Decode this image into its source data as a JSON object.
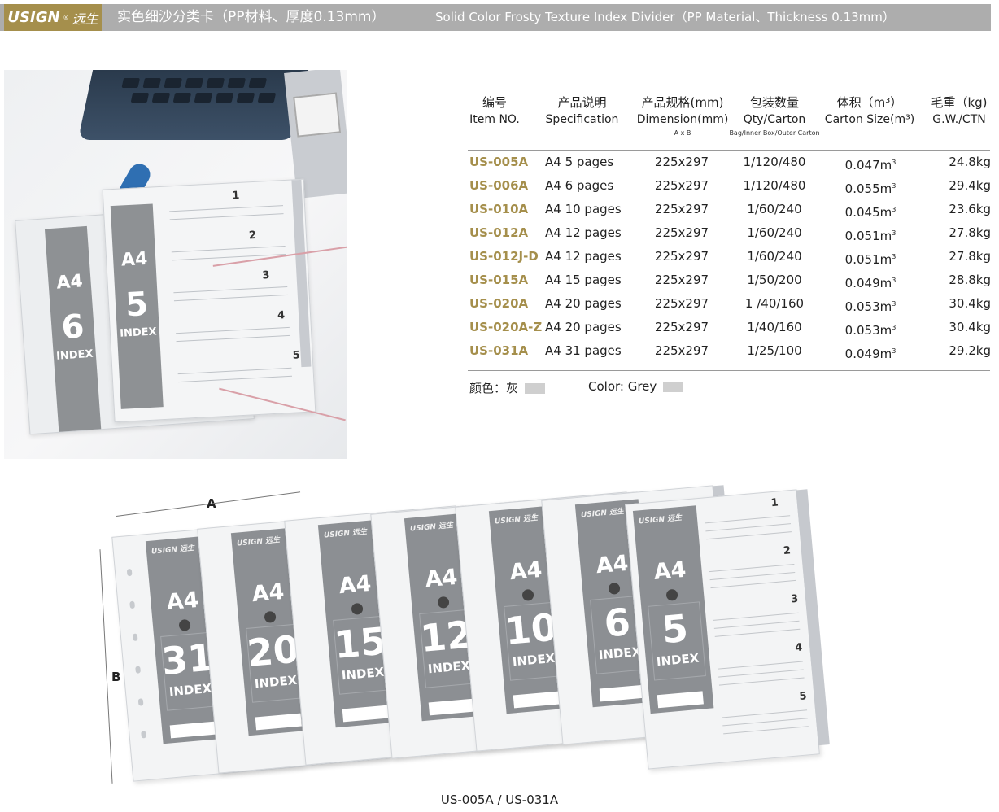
{
  "header": {
    "brand_mark": "USIGN",
    "brand_reg": "®",
    "brand_cn": "远生",
    "title_cn": "实色细沙分类卡（PP材料、厚度0.13mm）",
    "title_en": "Solid Color Frosty Texture Index Divider（PP Material、Thickness 0.13mm）"
  },
  "photo": {
    "sheets": [
      {
        "a4": "A4",
        "num": "6",
        "index": "INDEX"
      },
      {
        "a4": "A4",
        "num": "5",
        "index": "INDEX"
      }
    ],
    "tab_numbers": [
      "1",
      "2",
      "3",
      "4",
      "5"
    ]
  },
  "table": {
    "headers": [
      {
        "cn": "编号",
        "en": "Item NO.",
        "sub": ""
      },
      {
        "cn": "产品说明",
        "en": "Specification",
        "sub": ""
      },
      {
        "cn": "产品规格(mm)",
        "en": "Dimension(mm)",
        "sub": "A x B"
      },
      {
        "cn": "包装数量",
        "en": "Qty/Carton",
        "sub": "Bag/Inner Box/Outer Carton"
      },
      {
        "cn": "体积（m³）",
        "en": "Carton Size(m³)",
        "sub": ""
      },
      {
        "cn": "毛重（kg)",
        "en": "G.W./CTN",
        "sub": ""
      }
    ],
    "rows": [
      {
        "item": "US-005A",
        "spec": "A4  5 pages",
        "dim": "225x297",
        "qty": "1/120/480",
        "vol": "0.047m",
        "gw": "24.8kg"
      },
      {
        "item": "US-006A",
        "spec": "A4  6 pages",
        "dim": "225x297",
        "qty": "1/120/480",
        "vol": "0.055m",
        "gw": "29.4kg"
      },
      {
        "item": "US-010A",
        "spec": "A4  10 pages",
        "dim": "225x297",
        "qty": "1/60/240",
        "vol": "0.045m",
        "gw": "23.6kg"
      },
      {
        "item": "US-012A",
        "spec": "A4  12 pages",
        "dim": "225x297",
        "qty": "1/60/240",
        "vol": "0.051m",
        "gw": "27.8kg"
      },
      {
        "item": "US-012J-D",
        "spec": "A4  12 pages",
        "dim": "225x297",
        "qty": "1/60/240",
        "vol": "0.051m",
        "gw": "27.8kg"
      },
      {
        "item": "US-015A",
        "spec": "A4  15 pages",
        "dim": "225x297",
        "qty": "1/50/200",
        "vol": "0.049m",
        "gw": "28.8kg"
      },
      {
        "item": "US-020A",
        "spec": "A4  20 pages",
        "dim": "225x297",
        "qty": "1 /40/160",
        "vol": "0.053m",
        "gw": "30.4kg"
      },
      {
        "item": "US-020A-Z",
        "spec": "A4  20 pages",
        "dim": "225x297",
        "qty": "1/40/160",
        "vol": "0.053m",
        "gw": "30.4kg"
      },
      {
        "item": "US-031A",
        "spec": "A4  31 pages",
        "dim": "225x297",
        "qty": "1/25/100",
        "vol": "0.049m",
        "gw": "29.2kg"
      }
    ],
    "vol_sup": "3",
    "color_cn": "颜色：灰",
    "color_en": "Color: Grey"
  },
  "spread": {
    "dim_a": "A",
    "dim_b": "B",
    "sheets": [
      {
        "a4": "A4",
        "num": "31",
        "index": "INDEX",
        "logo": "USIGN 远生"
      },
      {
        "a4": "A4",
        "num": "20",
        "index": "INDEX",
        "logo": "USIGN 远生"
      },
      {
        "a4": "A4",
        "num": "15",
        "index": "INDEX",
        "logo": "USIGN 远生"
      },
      {
        "a4": "A4",
        "num": "12",
        "index": "INDEX",
        "logo": "USIGN 远生"
      },
      {
        "a4": "A4",
        "num": "10",
        "index": "INDEX",
        "logo": "USIGN 远生"
      },
      {
        "a4": "A4",
        "num": "6",
        "index": "INDEX",
        "logo": "USIGN 远生"
      },
      {
        "a4": "A4",
        "num": "5",
        "index": "INDEX",
        "logo": "USIGN 远生"
      }
    ],
    "front_tab_numbers": [
      "1",
      "2",
      "3",
      "4",
      "5"
    ],
    "caption": "US-005A  /  US-031A"
  },
  "colors": {
    "brand_gold": "#a58f4c",
    "banner_grey": "#adadad",
    "swatch_grey": "#cfcfcf"
  }
}
